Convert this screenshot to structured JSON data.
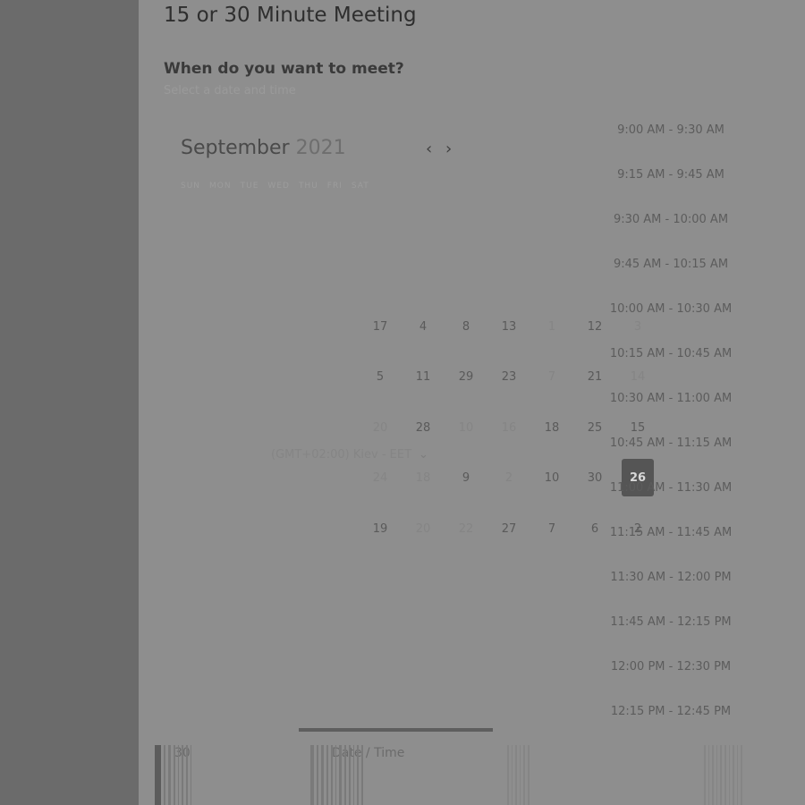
{
  "meeting": {
    "title": "15 or 30 Minute Meeting",
    "question": "When do you want to meet?",
    "subquestion": "Select a date and time"
  },
  "calendar": {
    "month": "September",
    "year": "2021",
    "prev_icon": "chevron-left-icon",
    "next_icon": "chevron-right-icon",
    "weekdays": [
      "SUN",
      "MON",
      "TUE",
      "WED",
      "THU",
      "FRI",
      "SAT"
    ],
    "rows": [
      [
        "17",
        "4",
        "8",
        "13",
        "1",
        "12",
        "3"
      ],
      [
        "5",
        "11",
        "29",
        "23",
        "7",
        "21",
        "14"
      ],
      [
        "20",
        "28",
        "10",
        "16",
        "18",
        "25",
        "15"
      ],
      [
        "24",
        "18",
        "9",
        "2",
        "10",
        "30",
        "26"
      ],
      [
        "19",
        "20",
        "22",
        "27",
        "7",
        "6",
        "2"
      ]
    ],
    "selected_day": "26",
    "timezone": "(GMT+02:00) Kiev - EET"
  },
  "time_slots": [
    "9:00 AM - 9:30 AM",
    "9:15 AM - 9:45 AM",
    "9:30 AM - 10:00 AM",
    "9:45 AM - 10:15 AM",
    "10:00 AM - 10:30 AM",
    "10:15 AM - 10:45 AM",
    "10:30 AM - 11:00 AM",
    "10:45 AM - 11:15 AM",
    "11:00 AM - 11:30 AM",
    "11:15 AM - 11:45 AM",
    "11:30 AM - 12:00 PM",
    "11:45 AM - 12:15 PM",
    "12:00 PM - 12:30 PM",
    "12:15 PM - 12:45 PM"
  ],
  "footer": {
    "left_label": "30",
    "middle_label": "Date / Time"
  },
  "colors": {
    "sidebar": "#6b6b6b",
    "main": "#8e8e8e",
    "selected_day": "#555555"
  }
}
